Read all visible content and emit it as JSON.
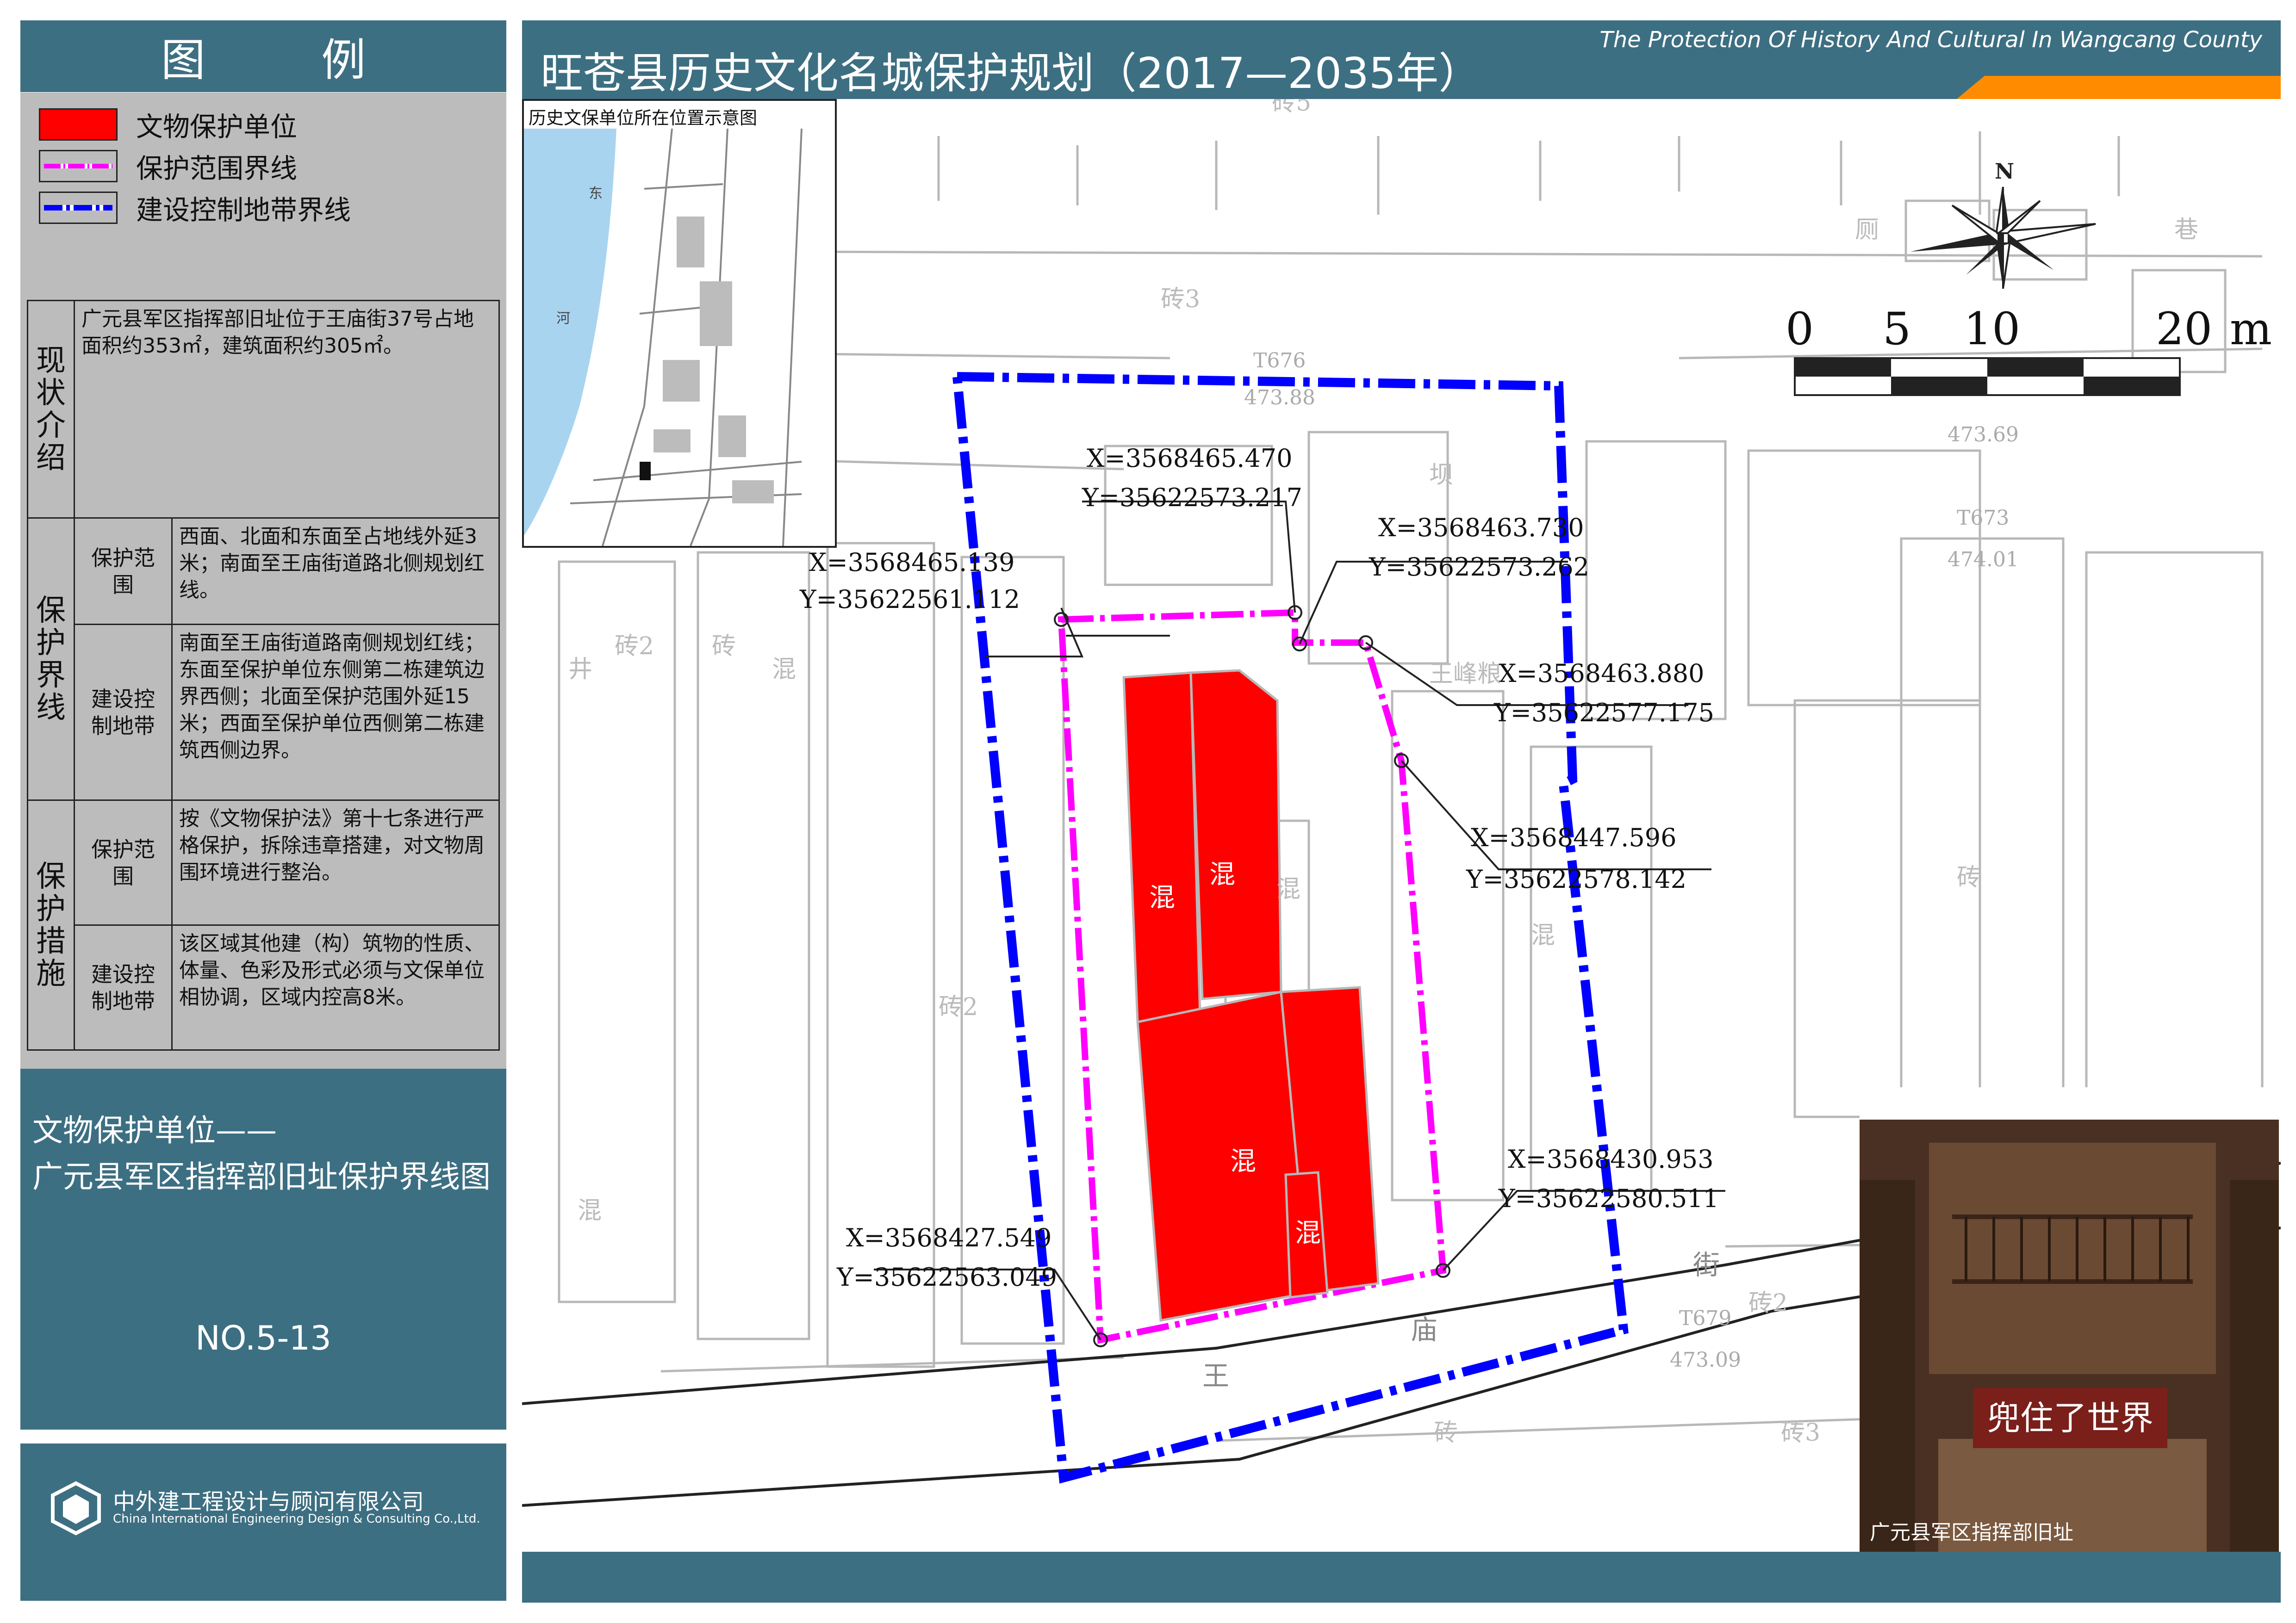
{
  "legend": {
    "title": "图  例",
    "items": [
      {
        "label": "文物保护单位",
        "color": "#ff0000"
      },
      {
        "label": "保护范围界线",
        "color": "#ff00ff"
      },
      {
        "label": "建设控制地带界线",
        "color": "#0000ff"
      }
    ]
  },
  "table": {
    "status_header": "现状介绍",
    "status_text": "广元县军区指挥部旧址位于王庙街37号占地面积约353㎡，建筑面积约305㎡。",
    "boundary_header": "保护界线",
    "boundary_protect_label": "保护范围",
    "boundary_protect_text": "西面、北面和东面至占地线外延3米；南面至王庙街道路北侧规划红线。",
    "boundary_control_label": "建设控制地带",
    "boundary_control_text": "南面至王庙街道路南侧规划红线；东面至保护单位东侧第二栋建筑边界西侧；北面至保护范围外延15米；西面至保护单位西侧第二栋建筑西侧边界。",
    "measures_header": "保护措施",
    "measures_protect_label": "保护范围",
    "measures_protect_text": "按《文物保护法》第十七条进行严格保护，拆除违章搭建，对文物周围环境进行整治。",
    "measures_control_label": "建设控制地带",
    "measures_control_text": "该区域其他建（构）筑物的性质、体量、色彩及形式必须与文保单位相协调，区域内控高8米。"
  },
  "unit": {
    "line1": "文物保护单位——",
    "line2": "广元县军区指挥部旧址保护界线图"
  },
  "drawing_number": "NO.5-13",
  "company": {
    "cn": "中外建工程设计与顾问有限公司",
    "en": "China International Engineering Design & Consulting Co.,Ltd."
  },
  "header": {
    "title": "旺苍县历史文化名城保护规划（2017—2035年）",
    "en_title": "The Protection Of History And Cultural In Wangcang County"
  },
  "inset": {
    "title": "历史文保单位所在位置示意图",
    "river_labels": [
      "东",
      "河"
    ]
  },
  "scale_bar": {
    "ticks": [
      "0",
      "5",
      "10",
      "20"
    ],
    "unit": "m"
  },
  "north_label": "N",
  "coordinates": [
    {
      "x": "X=3568465.470",
      "y": "Y=35622573.217"
    },
    {
      "x": "X=3568465.139",
      "y": "Y=35622561.112"
    },
    {
      "x": "X=3568463.730",
      "y": "Y=35622573.262"
    },
    {
      "x": "X=3568463.880",
      "y": "Y=35622577.175"
    },
    {
      "x": "X=3568447.596",
      "y": "Y=35622578.142"
    },
    {
      "x": "X=3568430.953",
      "y": "Y=35622580.511"
    },
    {
      "x": "X=3568427.549",
      "y": "Y=35622563.049"
    }
  ],
  "map_labels": {
    "street": [
      "王",
      "庙",
      "街"
    ],
    "elevations": [
      "473.88",
      "473.69",
      "474.01",
      "473.09"
    ],
    "points": [
      "T676",
      "T673",
      "T679"
    ],
    "building_material": [
      "砖5",
      "砖3",
      "砖2",
      "砖",
      "混",
      "厕",
      "巷",
      "坝",
      "井",
      "砖3",
      "王峰粮"
    ]
  },
  "photo": {
    "caption": "广元县军区指挥部旧址",
    "sign": "兜住了世界"
  }
}
